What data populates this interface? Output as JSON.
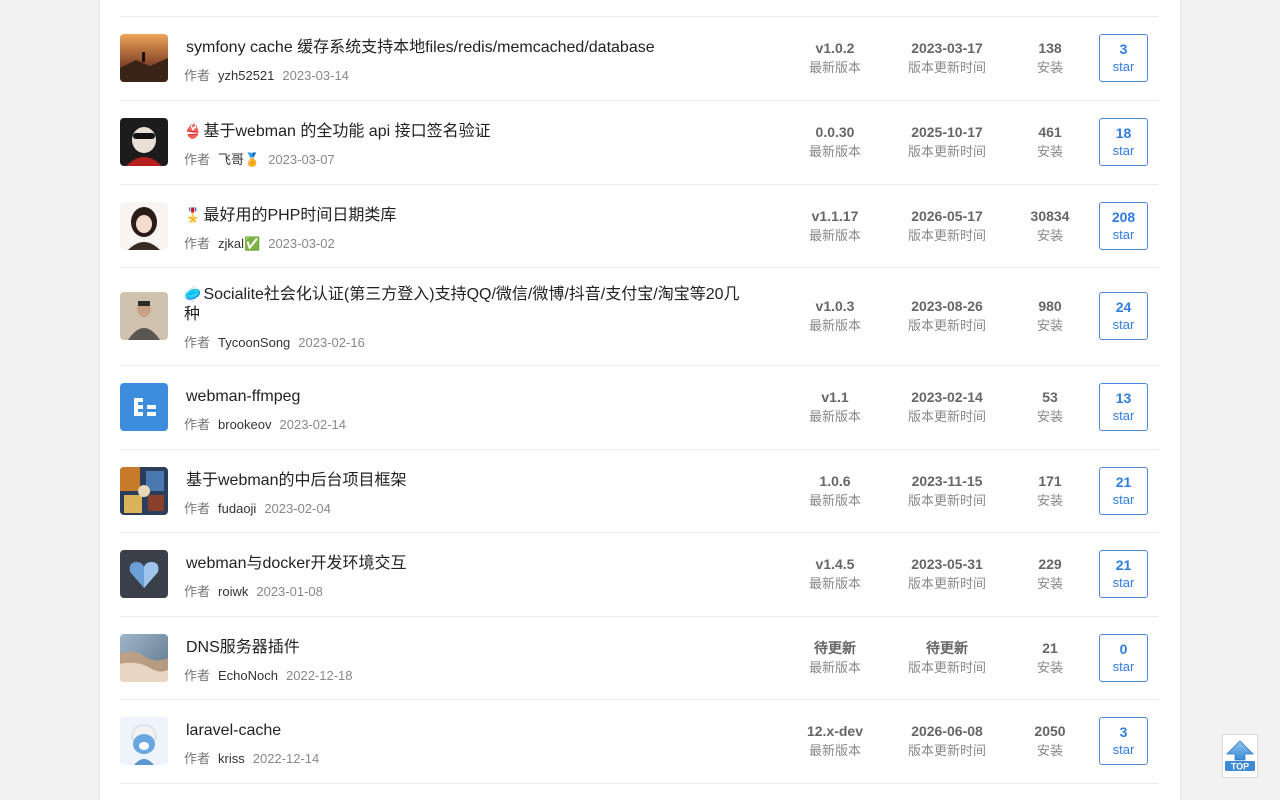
{
  "labels": {
    "author": "作者",
    "version": "最新版本",
    "update_time": "版本更新时间",
    "installs": "安装",
    "star": "star",
    "top": "TOP"
  },
  "plugins": [
    {
      "emoji": "",
      "title": "symfony cache 缓存系统支持本地files/redis/memcached/database",
      "author": "yzh52521",
      "date": "2023-03-14",
      "version": "v1.0.2",
      "update_time": "2023-03-17",
      "installs": "138",
      "stars": "3"
    },
    {
      "emoji": "👙",
      "title": "基于webman 的全功能 api 接口签名验证",
      "author": "飞哥🏅",
      "date": "2023-03-07",
      "version": "0.0.30",
      "update_time": "2025-10-17",
      "installs": "461",
      "stars": "18"
    },
    {
      "emoji": "🎖️",
      "title": "最好用的PHP时间日期类库",
      "author": "zjkal✅",
      "date": "2023-03-02",
      "version": "v1.1.17",
      "update_time": "2026-05-17",
      "installs": "30834",
      "stars": "208"
    },
    {
      "emoji": "🥏",
      "title": "Socialite社会化认证(第三方登入)支持QQ/微信/微博/抖音/支付宝/淘宝等20几种",
      "author": "TycoonSong",
      "date": "2023-02-16",
      "version": "v1.0.3",
      "update_time": "2023-08-26",
      "installs": "980",
      "stars": "24"
    },
    {
      "emoji": "",
      "title": "webman-ffmpeg",
      "author": "brookeov",
      "date": "2023-02-14",
      "version": "v1.1",
      "update_time": "2023-02-14",
      "installs": "53",
      "stars": "13"
    },
    {
      "emoji": "",
      "title": "基于webman的中后台项目框架",
      "author": "fudaoji",
      "date": "2023-02-04",
      "version": "1.0.6",
      "update_time": "2023-11-15",
      "installs": "171",
      "stars": "21"
    },
    {
      "emoji": "",
      "title": "webman与docker开发环境交互",
      "author": "roiwk",
      "date": "2023-01-08",
      "version": "v1.4.5",
      "update_time": "2023-05-31",
      "installs": "229",
      "stars": "21"
    },
    {
      "emoji": "",
      "title": "DNS服务器插件",
      "author": "EchoNoch",
      "date": "2022-12-18",
      "version": "待更新",
      "update_time": "待更新",
      "installs": "21",
      "stars": "0"
    },
    {
      "emoji": "",
      "title": "laravel-cache",
      "author": "kriss",
      "date": "2022-12-14",
      "version": "12.x-dev",
      "update_time": "2026-06-08",
      "installs": "2050",
      "stars": "3"
    }
  ]
}
